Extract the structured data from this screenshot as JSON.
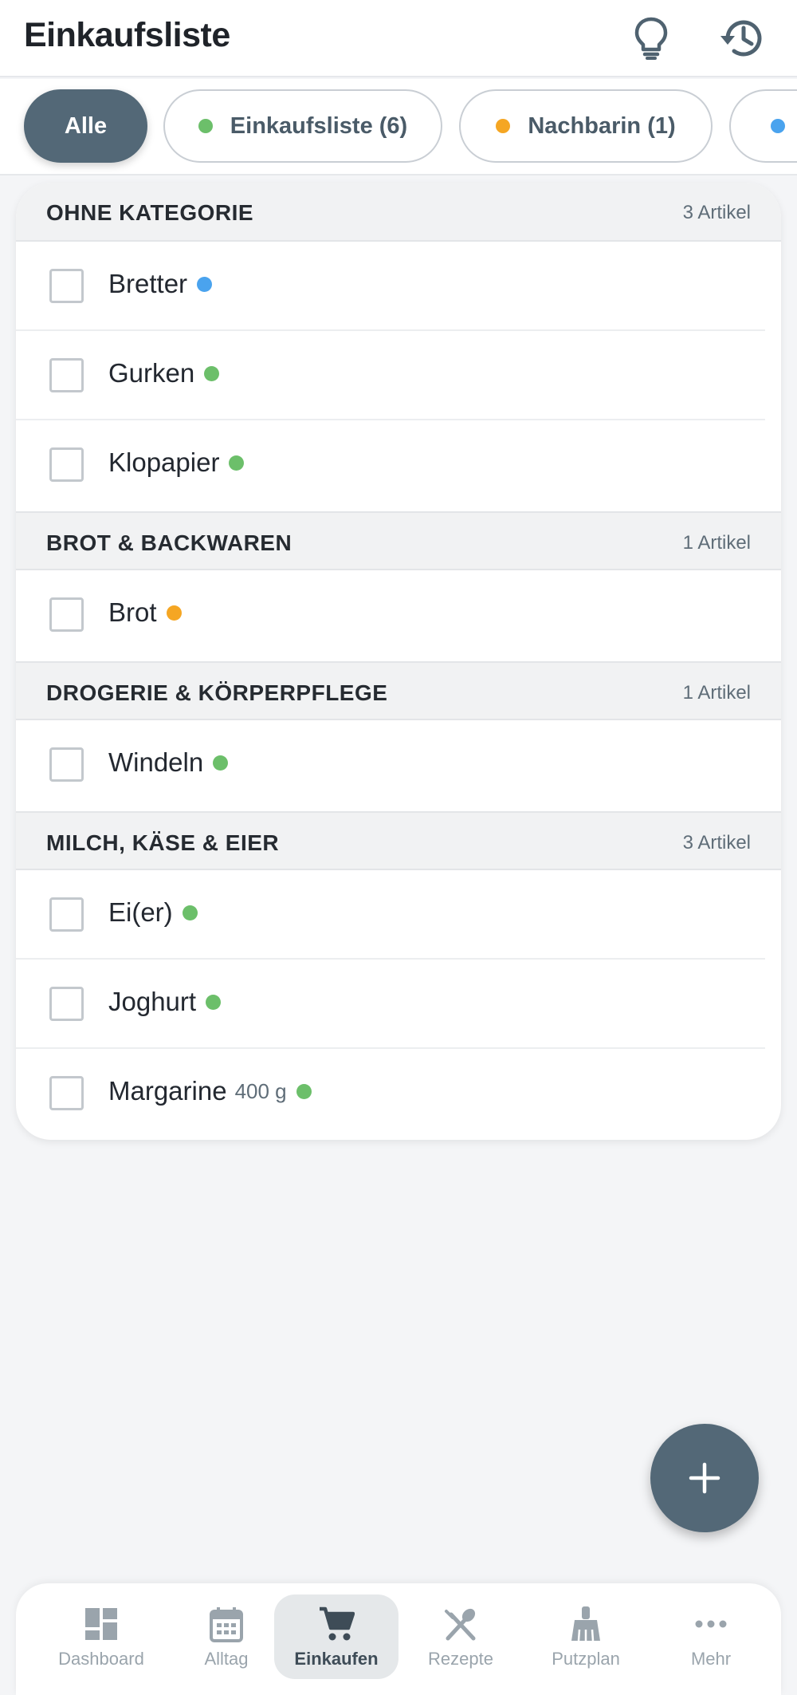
{
  "header": {
    "title": "Einkaufsliste",
    "icons": [
      "lightbulb-icon",
      "history-icon"
    ]
  },
  "filters": [
    {
      "label": "Alle",
      "active": true
    },
    {
      "label": "Einkaufsliste (6)",
      "dot_color": "#6cbf6a"
    },
    {
      "label": "Nachbarin (1)",
      "dot_color": "#f5a623"
    },
    {
      "label": "",
      "dot_color": "#4aa3ee"
    }
  ],
  "categories": [
    {
      "name": "OHNE KATEGORIE",
      "count": "3 Artikel",
      "items": [
        {
          "label": "Bretter",
          "dot": "#4aa3ee"
        },
        {
          "label": "Gurken",
          "dot": "#6cbf6a"
        },
        {
          "label": "Klopapier",
          "dot": "#6cbf6a"
        }
      ]
    },
    {
      "name": "BROT & BACKWAREN",
      "count": "1 Artikel",
      "items": [
        {
          "label": "Brot",
          "dot": "#f5a623"
        }
      ]
    },
    {
      "name": "DROGERIE & KÖRPERPFLEGE",
      "count": "1 Artikel",
      "items": [
        {
          "label": "Windeln",
          "dot": "#6cbf6a"
        }
      ]
    },
    {
      "name": "MILCH, KÄSE & EIER",
      "count": "3 Artikel",
      "items": [
        {
          "label": "Ei(er)",
          "dot": "#6cbf6a"
        },
        {
          "label": "Joghurt",
          "dot": "#6cbf6a"
        },
        {
          "label": "Margarine",
          "qty": "400 g",
          "dot": "#6cbf6a"
        }
      ]
    }
  ],
  "fab": {
    "icon": "plus-icon"
  },
  "nav": [
    {
      "label": "Dashboard",
      "icon": "dashboard-icon"
    },
    {
      "label": "Alltag",
      "icon": "calendar-icon"
    },
    {
      "label": "Einkaufen",
      "icon": "cart-icon",
      "active": true
    },
    {
      "label": "Rezepte",
      "icon": "utensils-icon"
    },
    {
      "label": "Putzplan",
      "icon": "broom-icon"
    },
    {
      "label": "Mehr",
      "icon": "more-icon"
    }
  ]
}
